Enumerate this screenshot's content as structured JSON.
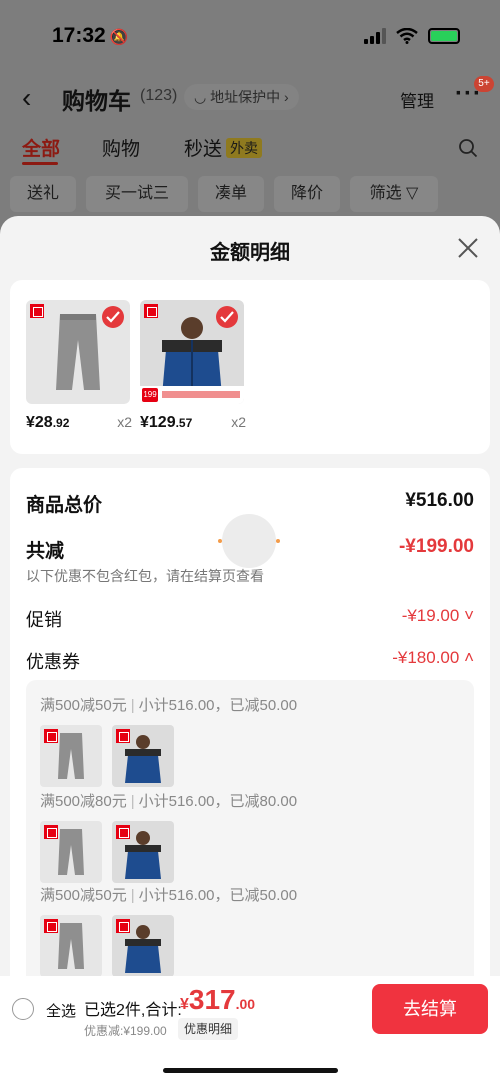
{
  "status_bar": {
    "time": "17:32"
  },
  "nav": {
    "title": "购物车",
    "count": "(123)",
    "address_chip": "◡ 地址保护中 ›",
    "manage": "管理",
    "more": "···",
    "more_badge": "5+"
  },
  "tabs": [
    {
      "label": "全部",
      "active": true
    },
    {
      "label": "购物"
    },
    {
      "label": "秒送",
      "badge": "外卖"
    }
  ],
  "filters": [
    "送礼",
    "买一试三",
    "凑单",
    "降价",
    "筛选 ▽"
  ],
  "sheet": {
    "title": "金额明细",
    "products": [
      {
        "price_int": "¥28",
        "price_dec": ".92",
        "qty": "x2",
        "name": "grey-sweatpants",
        "color": "#8f8f8f",
        "bg": "#e6e6e6"
      },
      {
        "price_int": "¥129",
        "price_dec": ".57",
        "qty": "x2",
        "name": "blue-puffer-jacket",
        "color": "#1e4c8f",
        "bg": "#dcdcdc"
      }
    ],
    "summary": {
      "total_label": "商品总价",
      "total_value": "¥516.00",
      "reduce_label": "共减",
      "reduce_value": "-¥199.00",
      "reduce_note": "以下优惠不包含红包，请在结算页查看",
      "promo_label": "促销",
      "promo_value": "-¥19.00 ˅",
      "coupon_label": "优惠券",
      "coupon_value": "-¥180.00 ˄"
    },
    "coupons": [
      {
        "rule": "满500减50元",
        "detail": "小计516.00，已减50.00"
      },
      {
        "rule": "满500减80元",
        "detail": "小计516.00，已减80.00"
      },
      {
        "rule": "满500减50元",
        "detail": "小计516.00，已减50.00"
      }
    ]
  },
  "bottom_bar": {
    "select_all": "全选",
    "selected": "已选2件,合计:",
    "currency": "¥",
    "total_int": "317",
    "total_dec": ".00",
    "discount": "优惠减:¥199.00",
    "detail_button": "优惠明细",
    "checkout_button": "去结算"
  },
  "colors": {
    "accent": "#e4393c",
    "checkout": "#f0333f",
    "tab_active": "#8c1a12"
  }
}
